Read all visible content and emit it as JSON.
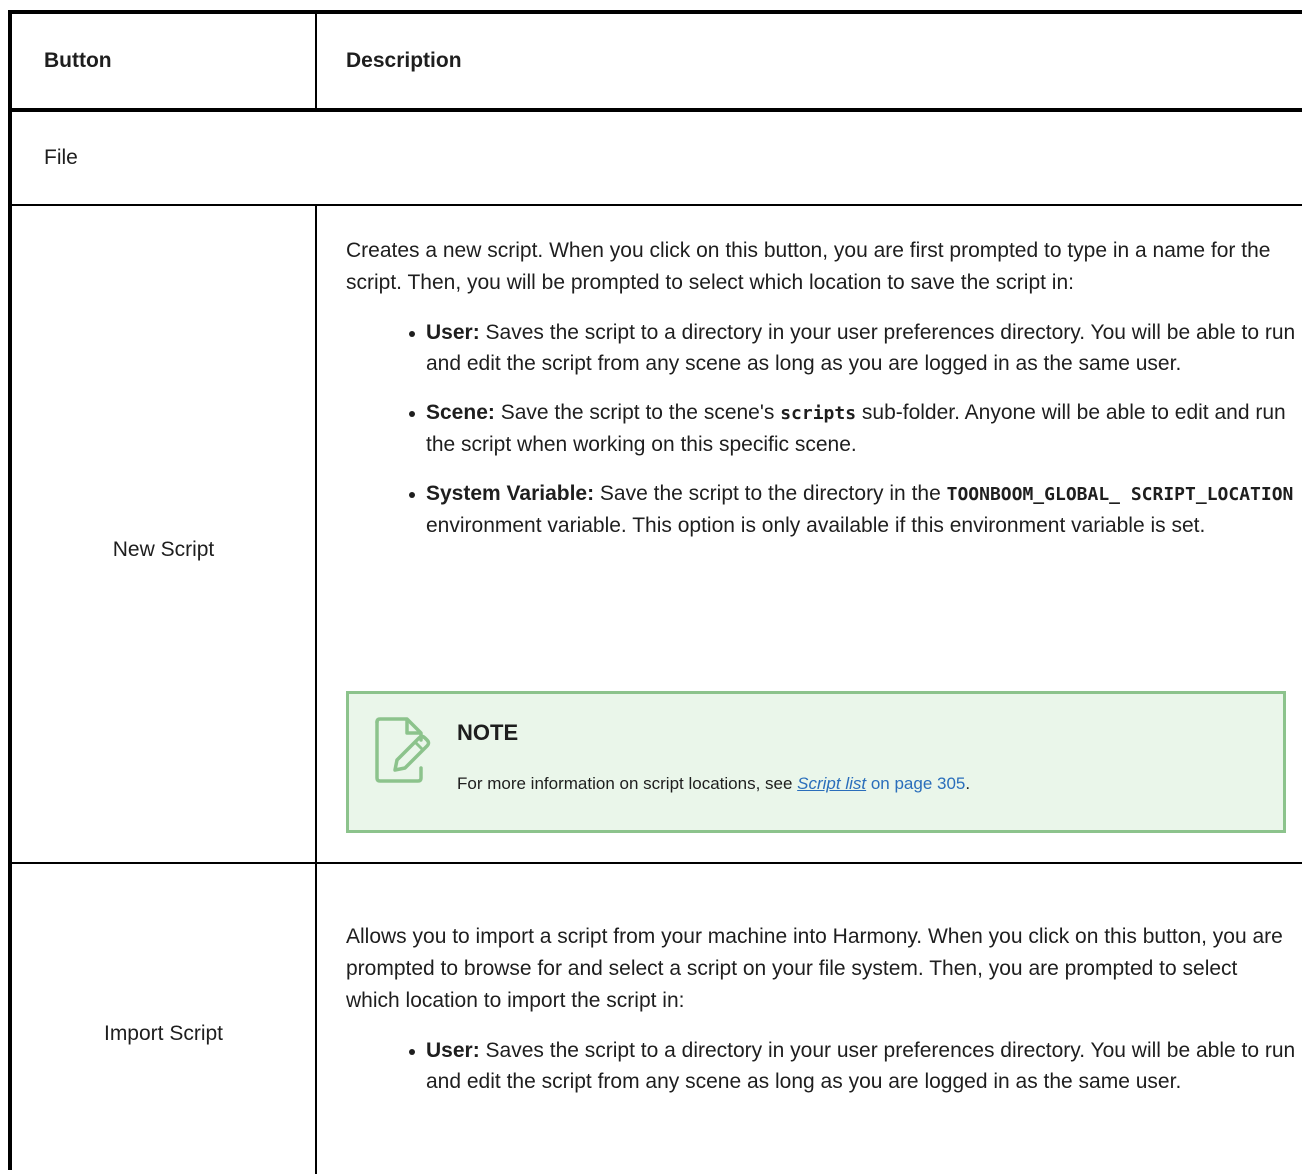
{
  "table": {
    "header": {
      "col1": "Button",
      "col2": "Description"
    },
    "section": "File",
    "rows": [
      {
        "button": "New Script",
        "intro": "Creates a new script. When you click on this button, you are first prompted to type in a name for the script. Then, you will be prompted to select which location to save the script in:",
        "options": [
          {
            "label": "User:",
            "text": " Saves the script to a directory in your user preferences directory. You will be able to run and edit the script from any scene as long as you are logged in as the same user."
          },
          {
            "label": "Scene:",
            "pre": " Save the script to the scene's ",
            "code": "scripts",
            "post": " sub-folder. Anyone will be able to edit and run the script when working on this specific scene."
          },
          {
            "label": "System Variable:",
            "pre": " Save the script to the directory in the ",
            "code": "TOONBOOM_GLOBAL_ SCRIPT_LOCATION",
            "post": " environment variable. This option is only available if this environment variable is set."
          }
        ],
        "note": {
          "title": "NOTE",
          "text_pre": "For more information on script locations, see ",
          "link_text": "Script list",
          "link_suffix": " on page 305",
          "text_post": "."
        }
      },
      {
        "button": "Import Script",
        "intro": "Allows you to import a script from your machine into Harmony. When you click on this button, you are prompted to browse for and select a script on your file system. Then, you are prompted to select which location to import the script in:",
        "options": [
          {
            "label": "User:",
            "text": " Saves the script to a directory in your user preferences directory. You will be able to run and edit the script from any scene as long as you are logged in as the same user."
          }
        ]
      }
    ]
  }
}
